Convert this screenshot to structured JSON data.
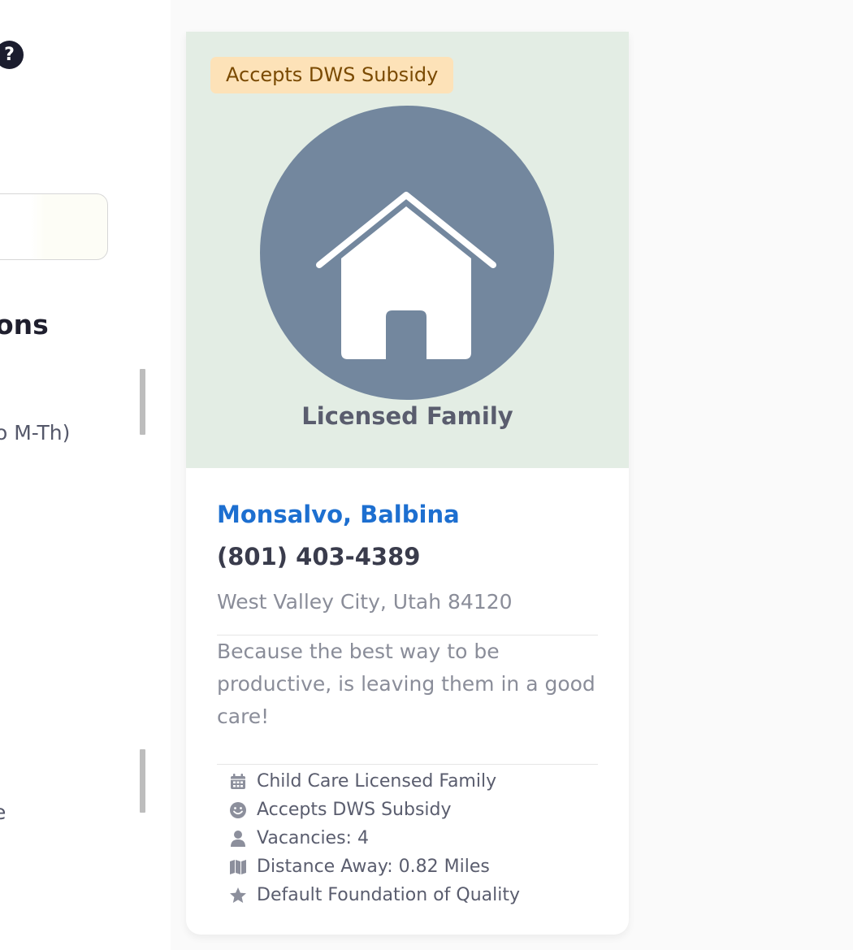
{
  "sidebar": {
    "help_icon_glyph": "?",
    "section_heading": "ons",
    "filter_text_1": "o M-Th)",
    "filter_text_2": "e"
  },
  "card": {
    "badge": "Accepts DWS Subsidy",
    "type_icon": "house-icon",
    "type_label": "Licensed Family",
    "name": "Monsalvo, Balbina",
    "phone": "(801) 403-4389",
    "location": "West Valley City, Utah 84120",
    "tagline": "Because the best way to be productive, is leaving them in a good care!",
    "details": [
      {
        "icon": "calendar-icon",
        "text": "Child Care Licensed Family"
      },
      {
        "icon": "smile-icon",
        "text": "Accepts DWS Subsidy"
      },
      {
        "icon": "user-icon",
        "text": "Vacancies: 4"
      },
      {
        "icon": "map-icon",
        "text": "Distance Away: 0.82 Miles"
      },
      {
        "icon": "star-icon",
        "text": "Default Foundation of Quality"
      }
    ]
  },
  "colors": {
    "hero_background": "#e3ede4",
    "type_circle": "#73879e",
    "badge_background": "#fde2b8",
    "badge_text": "#7a4a02",
    "name_link": "#1d6fd0"
  }
}
